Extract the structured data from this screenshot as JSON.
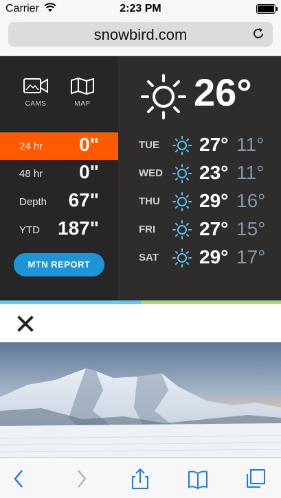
{
  "status_bar": {
    "carrier": "Carrier",
    "time": "2:23 PM"
  },
  "browser": {
    "url": "snowbird.com"
  },
  "widget": {
    "icons": [
      {
        "label": "CAMS",
        "icon": "video-camera-icon"
      },
      {
        "label": "MAP",
        "icon": "map-icon"
      }
    ],
    "snow": [
      {
        "label": "24 hr",
        "value": "0\"",
        "active": true
      },
      {
        "label": "48 hr",
        "value": "0\"",
        "active": false
      },
      {
        "label": "Depth",
        "value": "67\"",
        "active": false
      },
      {
        "label": "YTD",
        "value": "187\"",
        "active": false
      }
    ],
    "mtn_report_label": "MTN REPORT",
    "current_temp": "26°",
    "forecast": [
      {
        "day": "TUE",
        "hi": "27°",
        "lo": "11°"
      },
      {
        "day": "WED",
        "hi": "23°",
        "lo": "11°"
      },
      {
        "day": "THU",
        "hi": "29°",
        "lo": "16°"
      },
      {
        "day": "FRI",
        "hi": "27°",
        "lo": "15°"
      },
      {
        "day": "SAT",
        "hi": "29°",
        "lo": "17°"
      }
    ],
    "colors": {
      "accent_orange": "#ff5a00",
      "button_blue": "#1d95d6",
      "sun_blue": "#5fc3ee"
    }
  },
  "toolbar": [
    "back-icon",
    "forward-icon",
    "share-icon",
    "bookmarks-icon",
    "tabs-icon"
  ]
}
